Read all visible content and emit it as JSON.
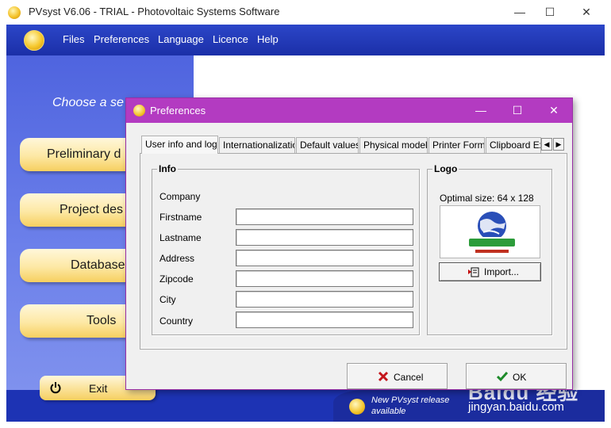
{
  "window": {
    "title": "PVsyst V6.06 - TRIAL - Photovoltaic Systems Software",
    "minimize": "—",
    "maximize": "☐",
    "close": "✕"
  },
  "menu": {
    "items": [
      "Files",
      "Preferences",
      "Language",
      "Licence",
      "Help"
    ]
  },
  "left_panel": {
    "choose_label": "Choose a se",
    "buttons": [
      "Preliminary d",
      "Project des",
      "Database",
      "Tools"
    ],
    "exit_label": "Exit"
  },
  "bottom": {
    "release_line1": "New PVsyst release",
    "release_line2": "available",
    "watermark": "Baidu 经验",
    "watermark_url": "jingyan.baidu.com"
  },
  "dialog": {
    "title": "Preferences",
    "minimize": "—",
    "maximize": "☐",
    "close": "✕",
    "tabs": [
      "User info and logo",
      "Internationalization",
      "Default values",
      "Physical models",
      "Printer Forms",
      "Clipboard Exp"
    ],
    "tab_scroll_left": "◀",
    "tab_scroll_right": "▶",
    "info": {
      "title": "Info",
      "fields": [
        {
          "label": "Company",
          "value": ""
        },
        {
          "label": "Firstname",
          "value": ""
        },
        {
          "label": "Lastname",
          "value": ""
        },
        {
          "label": "Address",
          "value": ""
        },
        {
          "label": "Zipcode",
          "value": ""
        },
        {
          "label": "City",
          "value": ""
        },
        {
          "label": "Country",
          "value": ""
        }
      ]
    },
    "logo": {
      "title": "Logo",
      "optimal_size": "Optimal size: 64 x 128",
      "import_label": "Import..."
    },
    "cancel_label": "Cancel",
    "ok_label": "OK"
  },
  "colors": {
    "menubar": "#1b2fa8",
    "dialog_title": "#b33bc1",
    "left_panel": "#5a6fe3",
    "button_gold": "#f6cf5f"
  }
}
